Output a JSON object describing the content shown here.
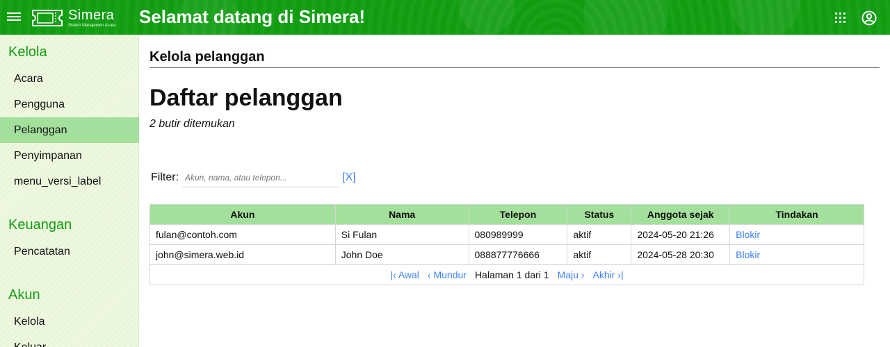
{
  "header": {
    "logo_name": "Simera",
    "logo_sub": "Sistem Manajemen Acara",
    "title": "Selamat datang di Simera!"
  },
  "sidebar": {
    "sections": [
      {
        "title": "Kelola",
        "items": [
          "Acara",
          "Pengguna",
          "Pelanggan",
          "Penyimpanan",
          "menu_versi_label"
        ]
      },
      {
        "title": "Keuangan",
        "items": [
          "Pencatatan"
        ]
      },
      {
        "title": "Akun",
        "items": [
          "Kelola",
          "Keluar"
        ]
      }
    ],
    "active_item": "Pelanggan"
  },
  "main": {
    "breadcrumb": "Kelola pelanggan",
    "title": "Daftar pelanggan",
    "count": "2 butir ditemukan",
    "filter": {
      "label": "Filter",
      "placeholder": "Akun, nama, atau telepon...",
      "value": "",
      "clear": "[X]"
    },
    "table": {
      "headers": [
        "Akun",
        "Nama",
        "Telepon",
        "Status",
        "Anggota sejak",
        "Tindakan"
      ],
      "rows": [
        [
          "fulan@contoh.com",
          "Si Fulan",
          "080989999",
          "aktif",
          "2024-05-20 21:26",
          "Blokir"
        ],
        [
          "john@simera.web.id",
          "John Doe",
          "088877776666",
          "aktif",
          "2024-05-28 20:30",
          "Blokir"
        ]
      ]
    },
    "pager": {
      "first": "Awal",
      "prev": "Mundur",
      "info": "Halaman 1 dari 1",
      "next": "Maju",
      "last": "Akhir"
    }
  },
  "colors": {
    "header": "#119d11",
    "accent_green": "#119d11",
    "active_row": "#a3e09c",
    "link": "#3b82f6"
  },
  "icons": [
    "hamburger-menu-icon",
    "ticket-logo-icon",
    "apps-grid-icon",
    "account-circle-icon"
  ]
}
